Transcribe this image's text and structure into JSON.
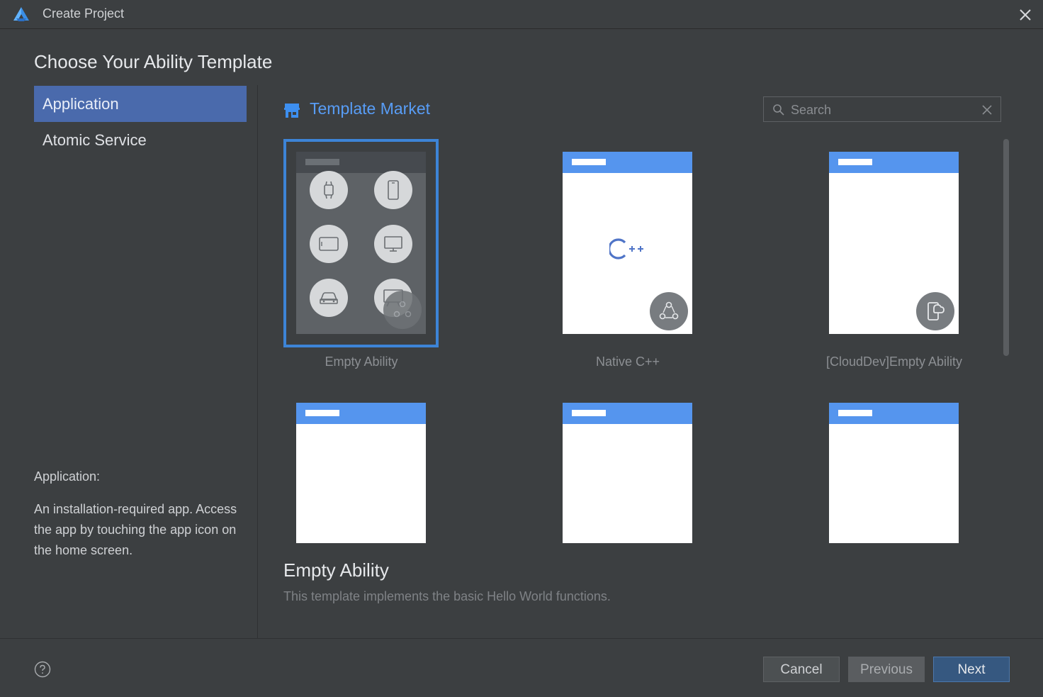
{
  "window": {
    "title": "Create Project"
  },
  "page": {
    "heading": "Choose Your Ability Template"
  },
  "sidebar": {
    "items": [
      {
        "label": "Application",
        "selected": true
      },
      {
        "label": "Atomic Service",
        "selected": false
      }
    ],
    "description": {
      "title": "Application:",
      "body": "An installation-required app. Access the app by touching the app icon on the home screen."
    }
  },
  "market": {
    "label": "Template Market",
    "icon": "store-icon"
  },
  "search": {
    "placeholder": "Search",
    "value": ""
  },
  "templates": [
    {
      "label": "Empty Ability",
      "selected": true,
      "badge": "devices-icon"
    },
    {
      "label": "Native C++",
      "selected": false,
      "thumb_text": "C++",
      "badge": "hub-icon"
    },
    {
      "label": "[CloudDev]Empty Ability",
      "selected": false,
      "badge": "cloud-device-icon"
    },
    {
      "label": "",
      "selected": false
    },
    {
      "label": "",
      "selected": false
    },
    {
      "label": "",
      "selected": false
    }
  ],
  "selected_info": {
    "title": "Empty Ability",
    "description": "This template implements the basic Hello World functions."
  },
  "footer": {
    "cancel_label": "Cancel",
    "previous_label": "Previous",
    "next_label": "Next"
  },
  "colors": {
    "background": "#3c3f41",
    "accent": "#4a6aac",
    "link": "#589df6",
    "selection_border": "#3d84d6",
    "template_header": "#5595ee"
  }
}
